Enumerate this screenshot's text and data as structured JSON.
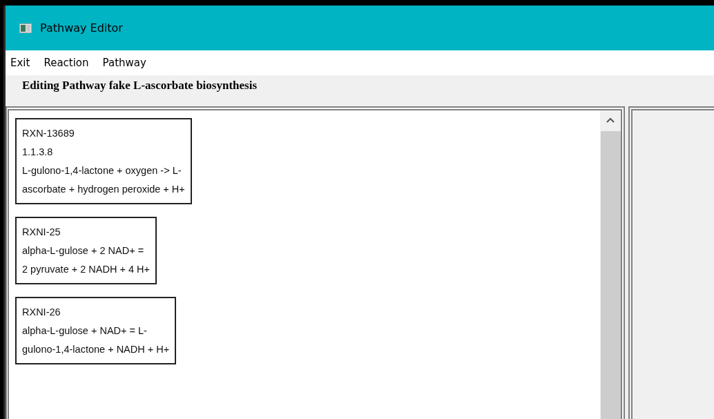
{
  "window": {
    "title": "Pathway Editor"
  },
  "menu": [
    {
      "label": "Exit"
    },
    {
      "label": "Reaction"
    },
    {
      "label": "Pathway"
    }
  ],
  "header": "Editing Pathway  fake L-ascorbate biosynthesis",
  "reactions": [
    {
      "lines": [
        "RXN-13689",
        "1.1.3.8",
        "L-gulono-1,4-lactone + oxygen  ->  L-",
        "ascorbate + hydrogen peroxide + H+"
      ]
    },
    {
      "lines": [
        "RXNI-25",
        "alpha-L-gulose + 2 NAD+  =",
        "2 pyruvate + 2 NADH + 4 H+"
      ]
    },
    {
      "lines": [
        "RXNI-26",
        "alpha-L-gulose + NAD+  =  L-",
        "gulono-1,4-lactone + NADH + H+"
      ]
    }
  ]
}
